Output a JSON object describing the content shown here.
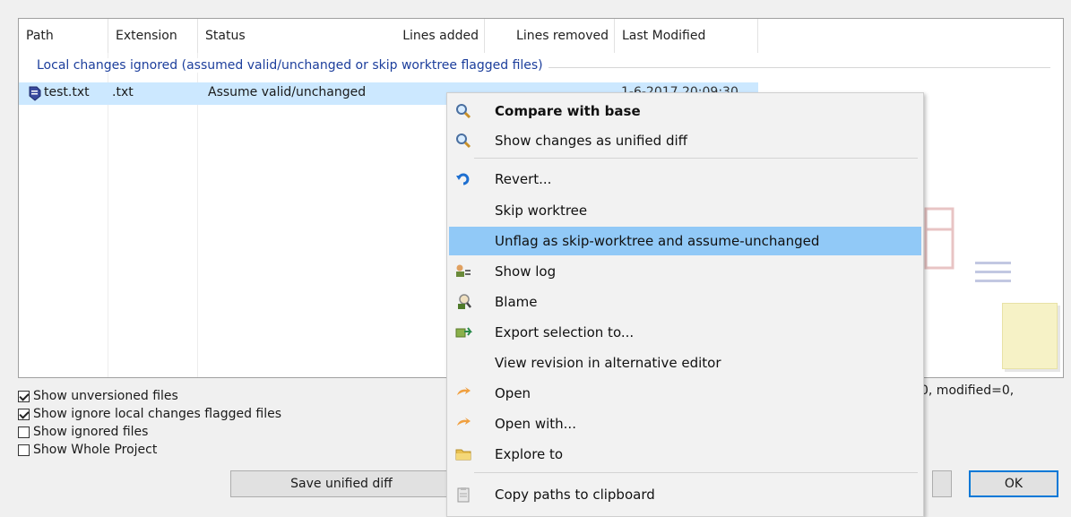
{
  "columns": [
    "Path",
    "Extension",
    "Status",
    "Lines added",
    "Lines removed",
    "Last Modified"
  ],
  "group_header": "Local changes ignored (assumed valid/unchanged or skip worktree flagged files)",
  "file": {
    "path": "test.txt",
    "extension": ".txt",
    "status": "Assume valid/unchanged",
    "last_modified_partial": "1-6-2017 20:09:30"
  },
  "checkboxes": [
    {
      "label": "Show unversioned files",
      "checked": true
    },
    {
      "label": "Show ignore local changes flagged files",
      "checked": true
    },
    {
      "label": "Show ignored files",
      "checked": false
    },
    {
      "label": "Show Whole Project",
      "checked": false
    }
  ],
  "stats_text": "0, modified=0,",
  "buttons": {
    "save_diff": "Save unified diff",
    "ok": "OK"
  },
  "context_menu": [
    {
      "label": "Compare with base",
      "icon": "magnifier-icon",
      "bold": true
    },
    {
      "label": "Show changes as unified diff",
      "icon": "magnifier-icon"
    },
    {
      "label": "Revert...",
      "icon": "revert-icon"
    },
    {
      "label": "Skip worktree",
      "icon": ""
    },
    {
      "label": "Unflag as skip-worktree and assume-unchanged",
      "icon": "",
      "highlighted": true
    },
    {
      "label": "Show log",
      "icon": "log-icon"
    },
    {
      "label": "Blame",
      "icon": "blame-icon"
    },
    {
      "label": "Export selection to...",
      "icon": "export-icon"
    },
    {
      "label": "View revision in alternative editor",
      "icon": ""
    },
    {
      "label": "Open",
      "icon": "open-icon"
    },
    {
      "label": "Open with...",
      "icon": "open-with-icon"
    },
    {
      "label": "Explore to",
      "icon": "folder-icon"
    },
    {
      "label": "Copy paths to clipboard",
      "icon": "clipboard-icon"
    }
  ],
  "colors": {
    "selection": "#cce8ff",
    "menu_highlight": "#91c9f7",
    "group_text": "#1c3e9c",
    "default_button_border": "#0078d7"
  }
}
